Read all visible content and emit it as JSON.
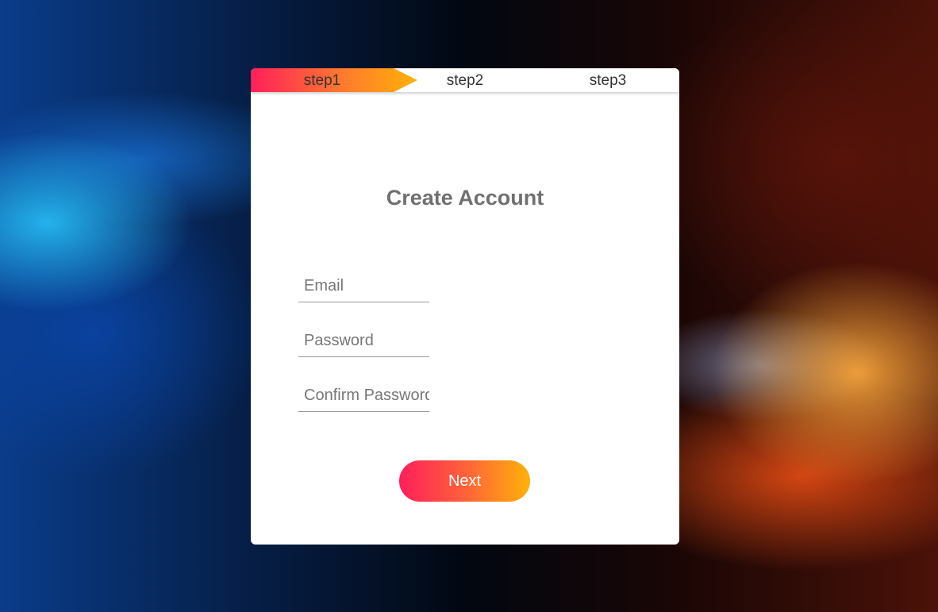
{
  "steps": [
    {
      "label": "step1",
      "active": true
    },
    {
      "label": "step2",
      "active": false
    },
    {
      "label": "step3",
      "active": false
    }
  ],
  "form": {
    "title": "Create Account",
    "email_placeholder": "Email",
    "password_placeholder": "Password",
    "confirm_placeholder": "Confirm Password",
    "next_label": "Next"
  },
  "colors": {
    "accent_start": "#ff1f5a",
    "accent_end": "#ffb10a"
  }
}
